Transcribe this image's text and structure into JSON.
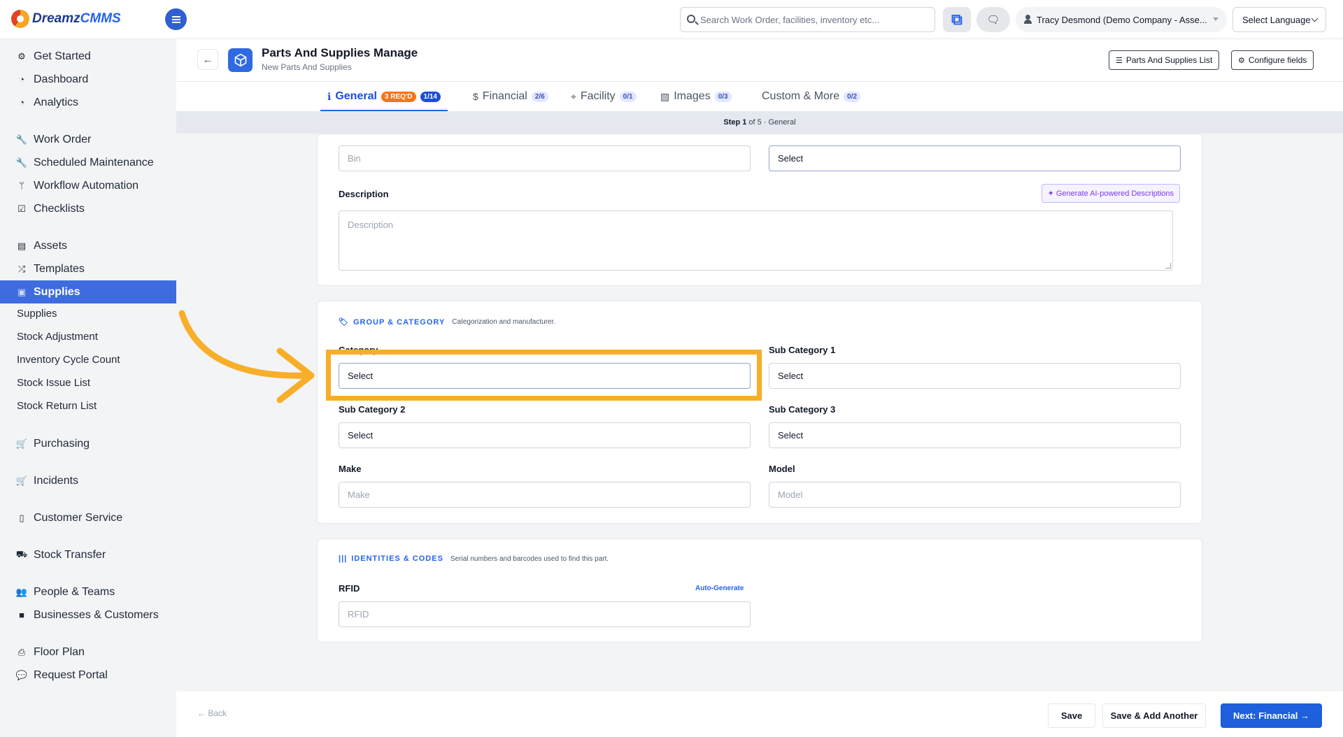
{
  "app": {
    "logo_text_a": "Dreamz",
    "logo_text_b": "CMMS"
  },
  "topbar": {
    "search_placeholder": "Search Work Order, facilities, inventory etc...",
    "user_name": "Tracy Desmond (Demo Company - Asse...",
    "language": "Select Language"
  },
  "sidebar": {
    "items": [
      {
        "label": "Get Started",
        "icon": "gears-icon"
      },
      {
        "label": "Dashboard",
        "icon": "gauge-icon"
      },
      {
        "label": "Analytics",
        "icon": "gauge-icon"
      },
      {
        "label": "Work Order",
        "icon": "wrench-icon"
      },
      {
        "label": "Scheduled Maintenance",
        "icon": "wrench-icon"
      },
      {
        "label": "Workflow Automation",
        "icon": "branch-icon"
      },
      {
        "label": "Checklists",
        "icon": "checkbox-icon"
      },
      {
        "label": "Assets",
        "icon": "archive-icon"
      },
      {
        "label": "Templates",
        "icon": "shuffle-icon"
      },
      {
        "label": "Supplies",
        "icon": "briefcase-icon"
      },
      {
        "label": "Supplies",
        "icon": ""
      },
      {
        "label": "Stock Adjustment",
        "icon": ""
      },
      {
        "label": "Inventory Cycle Count",
        "icon": ""
      },
      {
        "label": "Stock Issue List",
        "icon": ""
      },
      {
        "label": "Stock Return List",
        "icon": ""
      },
      {
        "label": "Purchasing",
        "icon": "cart-icon"
      },
      {
        "label": "Incidents",
        "icon": "cart-icon"
      },
      {
        "label": "Customer Service",
        "icon": "file-icon"
      },
      {
        "label": "Stock Transfer",
        "icon": "truck-icon"
      },
      {
        "label": "People & Teams",
        "icon": "users-icon"
      },
      {
        "label": "Businesses & Customers",
        "icon": "video-icon"
      },
      {
        "label": "Floor Plan",
        "icon": "printer-icon"
      },
      {
        "label": "Request Portal",
        "icon": "comment-icon"
      }
    ]
  },
  "header": {
    "title": "Parts And Supplies Manage",
    "subtitle": "New Parts And Supplies",
    "list_button": "Parts And Supplies List",
    "configure_button": "Configure fields"
  },
  "tabs": [
    {
      "label": "General",
      "badge_req": "3 REQ'D",
      "badge_count": "1/14"
    },
    {
      "label": "Financial",
      "badge_count": "2/6"
    },
    {
      "label": "Facility",
      "badge_count": "0/1"
    },
    {
      "label": "Images",
      "badge_count": "0/3"
    },
    {
      "label": "Custom & More",
      "badge_count": "0/2"
    }
  ],
  "stepbar": {
    "step": "Step 1",
    "rest": "of 5 · General"
  },
  "general_card": {
    "bin_placeholder": "Bin",
    "status_value": "Select",
    "description_label": "Description",
    "description_placeholder": "Description",
    "ai_button": "✦ Generate AI-powered Descriptions"
  },
  "group_category": {
    "title": "GROUP & CATEGORY",
    "desc": "Categorization and manufacturer.",
    "category_label": "Category",
    "category_value": "Select",
    "sub1_label": "Sub Category 1",
    "sub1_value": "Select",
    "sub2_label": "Sub Category 2",
    "sub2_value": "Select",
    "sub3_label": "Sub Category 3",
    "sub3_value": "Select",
    "make_label": "Make",
    "make_placeholder": "Make",
    "model_label": "Model",
    "model_placeholder": "Model"
  },
  "identities": {
    "title": "IDENTITIES & CODES",
    "desc": "Serial numbers and barcodes used to find this part.",
    "rfid_label": "RFID",
    "auto_generate": "Auto-Generate",
    "rfid_placeholder": "RFID"
  },
  "footer": {
    "back": "← Back",
    "save": "Save",
    "save_add": "Save & Add Another",
    "next": "Next: Financial →"
  },
  "colors": {
    "accent": "#2563eb",
    "highlight": "#f8ae28",
    "active_nav": "#3f6be0"
  }
}
